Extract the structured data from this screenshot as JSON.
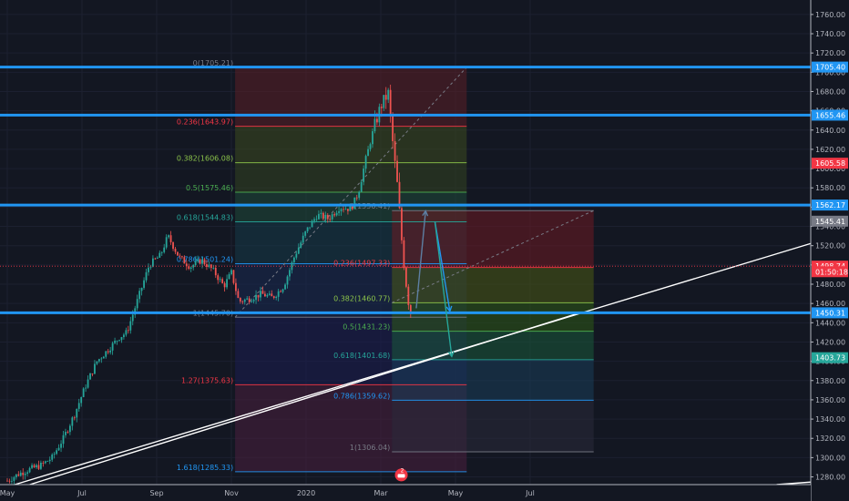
{
  "chart_data": {
    "type": "candlestick",
    "title": "",
    "y_axis": {
      "range": [
        1272,
        1775
      ],
      "ticks": [
        1280,
        1300,
        1320,
        1340,
        1360,
        1380,
        1400,
        1420,
        1440,
        1460,
        1480,
        1500,
        1520,
        1540,
        1560,
        1580,
        1600,
        1620,
        1640,
        1660,
        1680,
        1700,
        1720,
        1740,
        1760
      ],
      "tick_labels": [
        "1280.00",
        "1300.00",
        "1320.00",
        "1340.00",
        "1360.00",
        "1380.00",
        "1400.00",
        "1420.00",
        "1440.00",
        "1460.00",
        "1480.00",
        "1500.00",
        "1520.00",
        "1540.00",
        "1560.00",
        "1580.00",
        "1600.00",
        "1620.00",
        "1640.00",
        "1660.00",
        "1680.00",
        "1700.00",
        "1720.00",
        "1740.00",
        "1760.00"
      ]
    },
    "x_axis": {
      "labels": [
        {
          "text": "May",
          "month_index": 0
        },
        {
          "text": "Jul",
          "month_index": 2
        },
        {
          "text": "Sep",
          "month_index": 4
        },
        {
          "text": "Nov",
          "month_index": 6
        },
        {
          "text": "2020",
          "month_index": 8
        },
        {
          "text": "Mar",
          "month_index": 10
        },
        {
          "text": "May",
          "month_index": 12
        },
        {
          "text": "Jul",
          "month_index": 14
        }
      ]
    },
    "horizontal_levels": [
      {
        "price": 1705.4,
        "label": "1705.40",
        "color": "#2196f3"
      },
      {
        "price": 1655.46,
        "label": "1655.46",
        "color": "#2196f3"
      },
      {
        "price": 1562.17,
        "label": "1562.17",
        "color": "#2196f3"
      },
      {
        "price": 1450.31,
        "label": "1450.31",
        "color": "#2196f3"
      }
    ],
    "price_tags": [
      {
        "price": 1605.58,
        "label": "1605.58",
        "color": "#f23645"
      },
      {
        "price": 1545.41,
        "label": "1545.41",
        "color": "#787b86"
      },
      {
        "price": 1498.74,
        "label": "1498.74",
        "color": "#f23645"
      },
      {
        "price": 1493.0,
        "label": "01:50:18",
        "color": "#f23645"
      },
      {
        "price": 1403.73,
        "label": "1403.73",
        "color": "#26a69a"
      }
    ],
    "fib_retracement_1": {
      "x_start_month": 6.1,
      "x_end_month": 12.3,
      "levels": [
        {
          "ratio": "0",
          "price": 1705.21,
          "label": "0(1705.21)",
          "color": "#787b86"
        },
        {
          "ratio": "0.236",
          "price": 1643.97,
          "label": "0.236(1643.97)",
          "color": "#f23645"
        },
        {
          "ratio": "0.382",
          "price": 1606.08,
          "label": "0.382(1606.08)",
          "color": "#8bc34a"
        },
        {
          "ratio": "0.5",
          "price": 1575.46,
          "label": "0.5(1575.46)",
          "color": "#4caf50"
        },
        {
          "ratio": "0.618",
          "price": 1544.83,
          "label": "0.618(1544.83)",
          "color": "#26a69a"
        },
        {
          "ratio": "0.786",
          "price": 1501.24,
          "label": "0.786(1501.24)",
          "color": "#2196f3"
        },
        {
          "ratio": "1",
          "price": 1445.7,
          "label": "1(1445.70)",
          "color": "#787b86"
        },
        {
          "ratio": "1.27",
          "price": 1375.63,
          "label": "1.27(1375.63)",
          "color": "#f23645"
        },
        {
          "ratio": "1.618",
          "price": 1285.33,
          "label": "1.618(1285.33)",
          "color": "#2196f3"
        }
      ]
    },
    "fib_retracement_2": {
      "x_start_month": 10.3,
      "x_end_month": 15.7,
      "levels": [
        {
          "ratio": "0",
          "price": 1556.41,
          "label": "0(1556.41)",
          "color": "#787b86"
        },
        {
          "ratio": "0.236",
          "price": 1497.33,
          "label": "0.236(1497.33)",
          "color": "#f23645"
        },
        {
          "ratio": "0.382",
          "price": 1460.77,
          "label": "0.382(1460.77)",
          "color": "#8bc34a"
        },
        {
          "ratio": "0.5",
          "price": 1431.23,
          "label": "0.5(1431.23)",
          "color": "#4caf50"
        },
        {
          "ratio": "0.618",
          "price": 1401.68,
          "label": "0.618(1401.68)",
          "color": "#26a69a"
        },
        {
          "ratio": "0.786",
          "price": 1359.62,
          "label": "0.786(1359.62)",
          "color": "#2196f3"
        },
        {
          "ratio": "1",
          "price": 1306.04,
          "label": "1(1306.04)",
          "color": "#787b86"
        }
      ]
    },
    "trend_lines": [
      {
        "from": [
          0.2,
          1272
        ],
        "to": [
          22.0,
          1528
        ],
        "color": "#ffffff"
      },
      {
        "from": [
          0.6,
          1272
        ],
        "to": [
          15.3,
          1450
        ],
        "color": "#ffffff"
      },
      {
        "from": [
          20.6,
          1272
        ],
        "to": [
          22.0,
          1276
        ],
        "color": "#ffffff"
      }
    ],
    "price_path": [
      [
        0.0,
        1276
      ],
      [
        0.3,
        1283
      ],
      [
        0.6,
        1288
      ],
      [
        0.9,
        1292
      ],
      [
        1.2,
        1300
      ],
      [
        1.5,
        1320
      ],
      [
        1.8,
        1345
      ],
      [
        2.1,
        1375
      ],
      [
        2.4,
        1400
      ],
      [
        2.7,
        1412
      ],
      [
        3.0,
        1425
      ],
      [
        3.2,
        1430
      ],
      [
        3.5,
        1465
      ],
      [
        3.8,
        1500
      ],
      [
        4.1,
        1510
      ],
      [
        4.3,
        1530
      ],
      [
        4.6,
        1508
      ],
      [
        4.9,
        1498
      ],
      [
        5.2,
        1505
      ],
      [
        5.5,
        1495
      ],
      [
        5.8,
        1478
      ],
      [
        6.0,
        1492
      ],
      [
        6.2,
        1462
      ],
      [
        6.5,
        1465
      ],
      [
        6.8,
        1470
      ],
      [
        7.1,
        1466
      ],
      [
        7.4,
        1478
      ],
      [
        7.7,
        1510
      ],
      [
        8.0,
        1535
      ],
      [
        8.3,
        1552
      ],
      [
        8.6,
        1548
      ],
      [
        8.9,
        1560
      ],
      [
        9.2,
        1558
      ],
      [
        9.4,
        1575
      ],
      [
        9.6,
        1610
      ],
      [
        9.8,
        1640
      ],
      [
        10.0,
        1665
      ],
      [
        10.2,
        1678
      ],
      [
        10.35,
        1615
      ],
      [
        10.45,
        1580
      ],
      [
        10.55,
        1530
      ],
      [
        10.65,
        1490
      ],
      [
        10.75,
        1460
      ],
      [
        10.85,
        1448
      ]
    ],
    "arrows": [
      {
        "from": [
          10.95,
          1455
        ],
        "to": [
          11.2,
          1556
        ],
        "color": "#5d7fa3"
      },
      {
        "from": [
          11.45,
          1545
        ],
        "to": [
          11.85,
          1452
        ],
        "color": "#2196f3"
      },
      {
        "from": [
          11.45,
          1545
        ],
        "to": [
          11.9,
          1405
        ],
        "color": "#26a69a"
      }
    ],
    "event_badge": {
      "month": 10.55,
      "price": 1282,
      "text": "2"
    }
  }
}
